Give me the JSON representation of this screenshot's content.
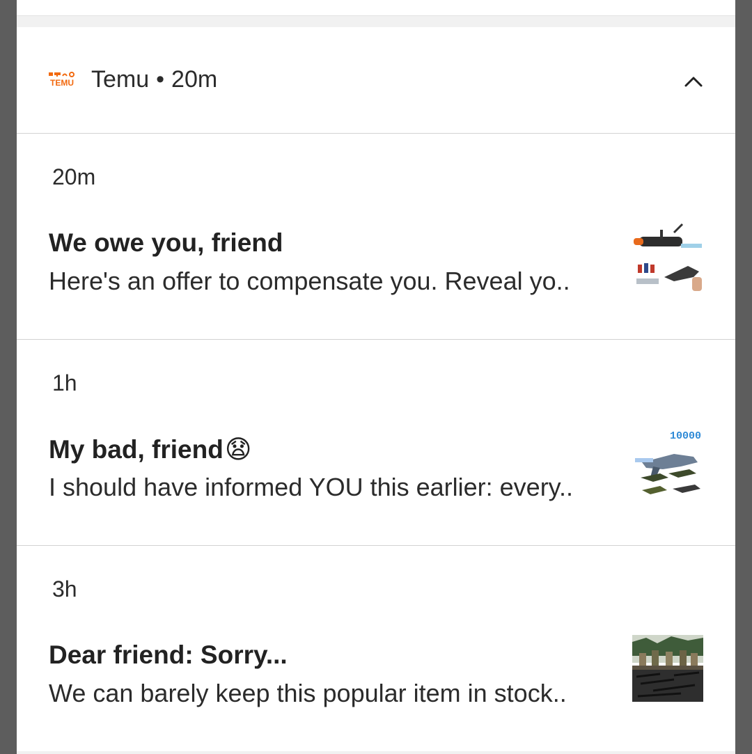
{
  "group": {
    "app_name": "Temu",
    "separator": "•",
    "time": "20m",
    "logo_text": "TEMU",
    "brand_color": "#f26a10"
  },
  "notifications": [
    {
      "time": "20m",
      "title": "We owe you, friend",
      "emoji": "",
      "body": "Here's an offer to compensate you. Reveal yo..",
      "thumb_icon": "toy-launcher-thumbnail"
    },
    {
      "time": "1h",
      "title": "My bad, friend",
      "emoji": "😧",
      "body": "I should have informed YOU this earlier: every..",
      "thumb_icon": "toy-gun-set-thumbnail",
      "thumb_label": "10000"
    },
    {
      "time": "3h",
      "title": "Dear friend: Sorry...",
      "emoji": "",
      "body": "We can barely keep this popular item in stock..",
      "thumb_icon": "military-figures-thumbnail"
    }
  ],
  "colors": {
    "text": "#2b2b2b",
    "divider": "#d2d2d2",
    "backdrop": "#5d5d5d"
  }
}
